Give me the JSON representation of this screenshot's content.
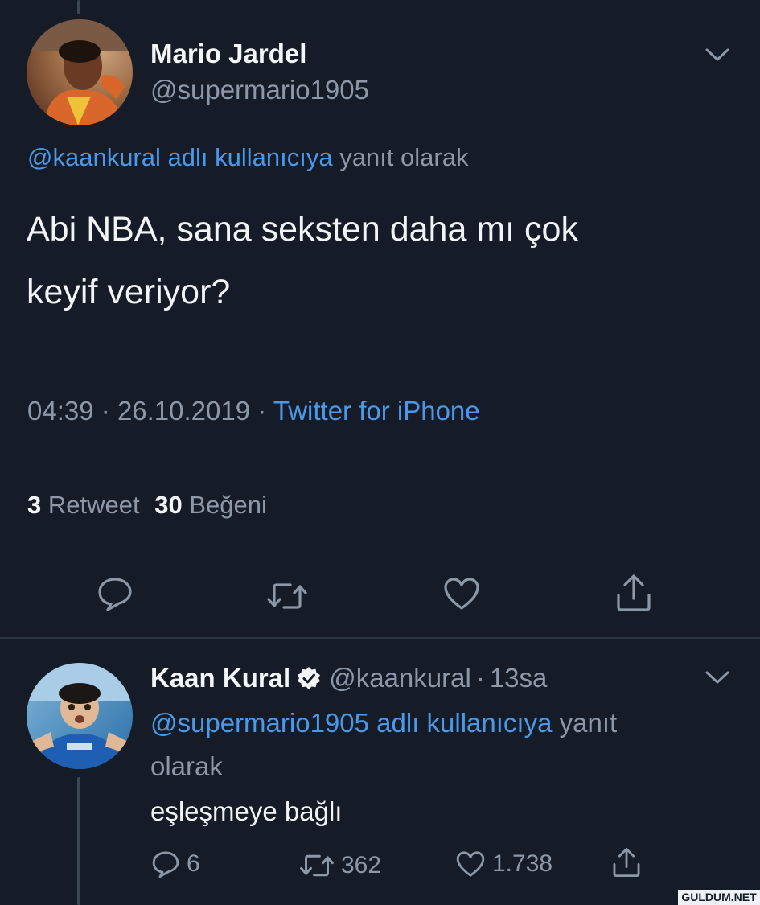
{
  "tweet": {
    "author_name": "Mario Jardel",
    "author_handle": "@supermario1905",
    "reply_prefix": "@kaankural adlı kullanıcıya",
    "reply_suffix": "yanıt olarak",
    "text_line1": "Abi NBA, sana seksten daha mı çok",
    "text_line2": "keyif veriyor?",
    "time": "04:39",
    "sep1": "·",
    "date": "26.10.2019",
    "sep2": "·",
    "source": "Twitter for iPhone",
    "retweet_count": "3",
    "retweet_label": "Retweet",
    "like_count": "30",
    "like_label": "Beğeni"
  },
  "reply": {
    "author_name": "Kaan Kural",
    "author_handle": "@kaankural",
    "sep": "·",
    "time": "13sa",
    "reply_prefix": "@supermario1905 adlı kullanıcıya",
    "reply_suffix_1": "yanıt",
    "reply_suffix_2": "olarak",
    "text": "eşleşmeye bağlı",
    "reply_count": "6",
    "retweet_count": "362",
    "like_count": "1.738"
  },
  "watermark": "GULDUM.NET",
  "icons": {
    "chevron": "chevron-down-icon",
    "reply": "reply-icon",
    "retweet": "retweet-icon",
    "like": "heart-icon",
    "share": "share-icon",
    "verified": "verified-badge-icon"
  },
  "colors": {
    "background": "#151c28",
    "link": "#4a99e9",
    "muted": "#8c98a8",
    "text": "#eef1f5"
  }
}
